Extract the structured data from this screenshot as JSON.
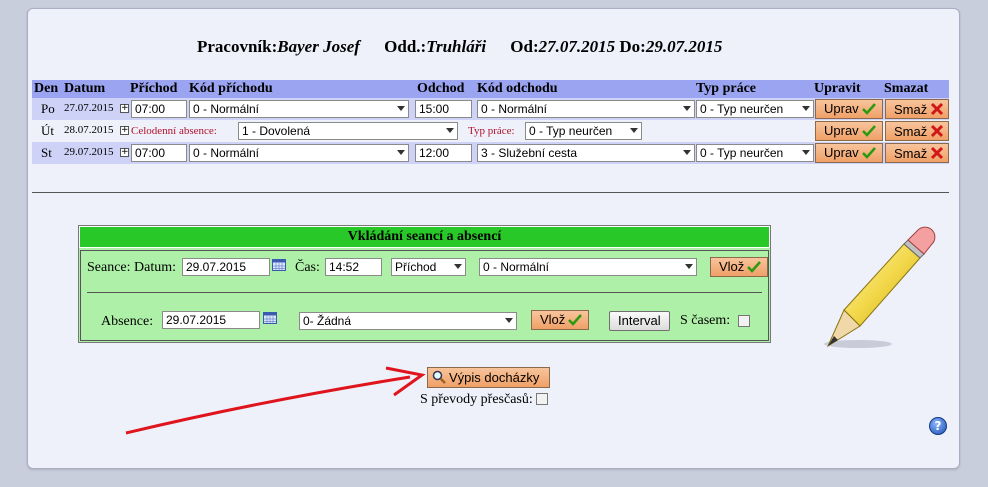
{
  "header": {
    "worker_label": "Pracovník:",
    "worker_name": "Bayer Josef",
    "dept_label": "Odd.:",
    "dept_name": "Truhláři",
    "from_label": "Od:",
    "from_date": "27.07.2015",
    "to_label": "Do:",
    "to_date": "29.07.2015"
  },
  "table": {
    "columns": [
      "Den",
      "Datum",
      "Příchod",
      "Kód příchodu",
      "Odchod",
      "Kód odchodu",
      "Typ práce",
      "Upravit",
      "Smazat"
    ],
    "rows": [
      {
        "day": "Po",
        "date": "27.07.2015",
        "arrival": "07:00",
        "arrival_code": "0 - Normální",
        "departure": "15:00",
        "departure_code": "0 - Normální",
        "work_type": "0 - Typ neurčen"
      },
      {
        "day": "Út",
        "date": "28.07.2015",
        "absence_label": "Celodenní absence:",
        "absence_value": "1 - Dovolená",
        "work_type_label": "Typ práce:",
        "work_type": "0 - Typ neurčen"
      },
      {
        "day": "St",
        "date": "29.07.2015",
        "arrival": "07:00",
        "arrival_code": "0 - Normální",
        "departure": "12:00",
        "departure_code": "3 - Služební cesta",
        "work_type": "0 - Typ neurčen"
      }
    ],
    "edit_label": "Uprav",
    "delete_label": "Smaž"
  },
  "insert": {
    "title": "Vkládání seancí a absencí",
    "seance_label": "Seance: Datum:",
    "seance_date": "29.07.2015",
    "time_label": "Čas:",
    "time_value": "14:52",
    "direction": "Příchod",
    "code": "0 - Normální",
    "insert_label": "Vlož",
    "absence_label": "Absence:",
    "absence_date": "29.07.2015",
    "absence_type": "0- Žádná",
    "interval_label": "Interval",
    "with_time_label": "S časem:"
  },
  "report": {
    "button_label": "Výpis docházky",
    "overtime_label": "S převody přesčasů:"
  },
  "help": "?"
}
